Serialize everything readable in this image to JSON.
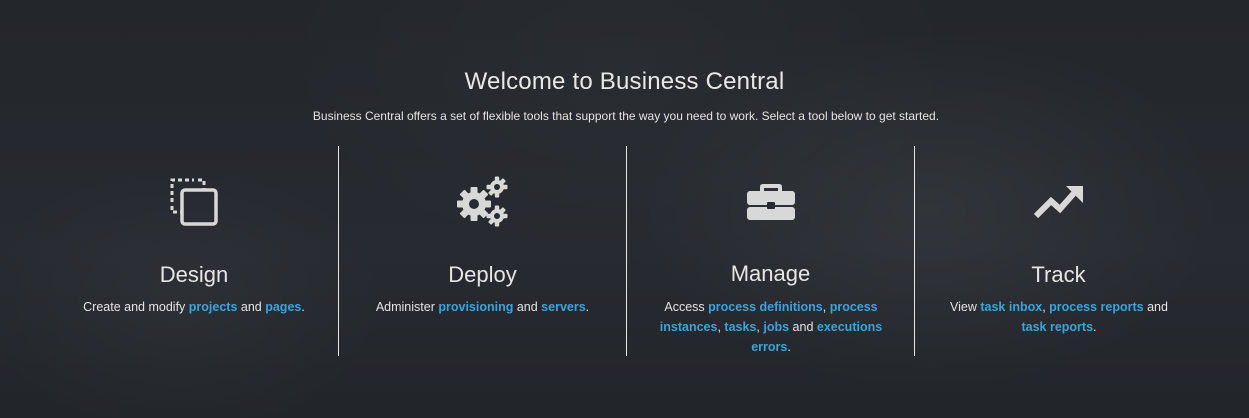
{
  "welcome": {
    "title": "Welcome to Business Central",
    "subtitle": "Business Central offers a set of flexible tools that support the way you need to work. Select a tool below to get started."
  },
  "cards": {
    "design": {
      "icon": "copy-icon",
      "title": "Design",
      "text_1": "Create and modify ",
      "link_projects": "projects",
      "text_2": " and ",
      "link_pages": "pages",
      "text_3": "."
    },
    "deploy": {
      "icon": "gears-icon",
      "title": "Deploy",
      "text_1": "Administer ",
      "link_provisioning": "provisioning",
      "text_2": " and ",
      "link_servers": "servers",
      "text_3": "."
    },
    "manage": {
      "icon": "briefcase-icon",
      "title": "Manage",
      "text_1": "Access ",
      "link_process_definitions": "process definitions",
      "sep_1": ", ",
      "link_process_instances": "process instances",
      "sep_2": ", ",
      "link_tasks": "tasks",
      "sep_3": ", ",
      "link_jobs": "jobs",
      "text_2": " and ",
      "link_executions_errors": "executions errors",
      "text_3": "."
    },
    "track": {
      "icon": "trend-up-icon",
      "title": "Track",
      "text_1": "View ",
      "link_task_inbox": "task inbox",
      "sep_1": ", ",
      "link_process_reports": "process reports",
      "text_2": " and ",
      "link_task_reports": "task reports",
      "text_3": "."
    }
  },
  "colors": {
    "background": "#24272c",
    "link": "#39a5dc",
    "text": "#e6e6e6"
  }
}
